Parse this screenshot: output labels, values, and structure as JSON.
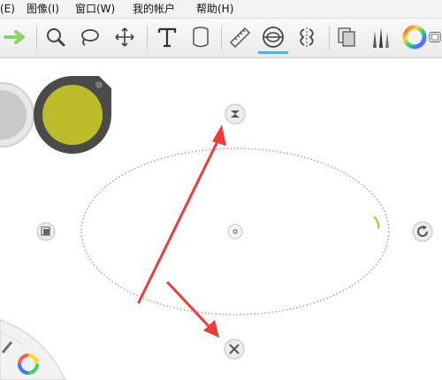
{
  "menu": {
    "items": [
      {
        "label": "(E)"
      },
      {
        "label": "图像(I)"
      },
      {
        "label": "窗口(W)"
      },
      {
        "label": "我的帐户"
      },
      {
        "label": "帮助(H)"
      }
    ]
  },
  "toolbar": {
    "tools": [
      "redo-arrow-icon",
      "zoom-icon",
      "lasso-icon",
      "move-icon",
      "text-icon",
      "fill-bucket-icon",
      "ruler-icon",
      "ellipse-guide-icon",
      "symmetry-icon",
      "layers-icon",
      "brush-set-icon",
      "color-wheel-icon",
      "copic-icon"
    ],
    "active_tool": "ellipse-guide-icon"
  },
  "colors": {
    "brush_puck_color": "#bcbc2a",
    "arrow_color": "#ee3b3b",
    "accent": "#55aee8"
  }
}
